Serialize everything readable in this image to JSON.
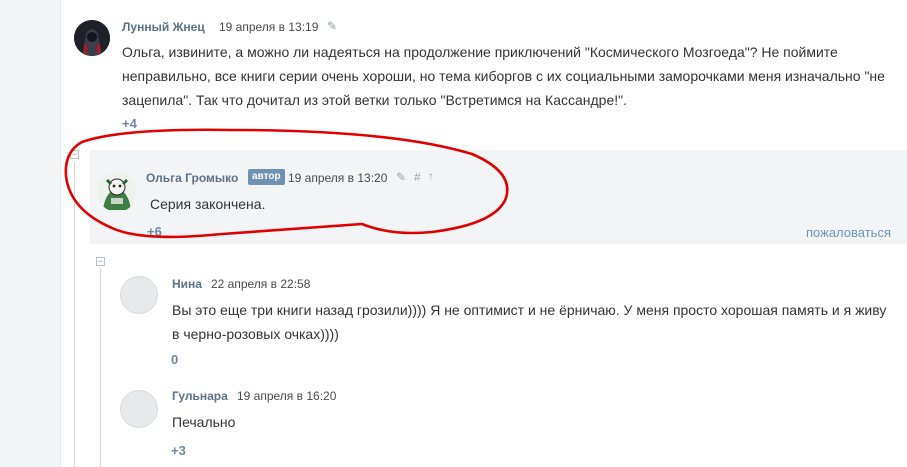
{
  "comments": [
    {
      "author": "Лунный Жнец",
      "date": "19 апреля в 13:19",
      "text_line1": "Ольга, извините, а можно ли надеяться на продолжение приключений \"Космического Мозгоеда\"? Не поймите",
      "text_line2": "неправильно, все книги серии очень хороши, но тема киборгов с их социальными заморочками меня изначально \"не",
      "text_line3": "зацепила\". Так что дочитал из этой ветки только \"Встретимся на Кассандре!\".",
      "rating": "+4",
      "avatar_icon": "dark-hooded-figure-avatar"
    },
    {
      "author": "Ольга Громыко",
      "badge": "автор",
      "date": "19 апреля в 13:20",
      "text": "Серия закончена.",
      "rating": "+6",
      "report": "пожаловаться",
      "collapse": "⊟",
      "edit_icon": "✎",
      "hash_icon": "#",
      "up_icon": "↑",
      "highlight_color": "#e00000"
    },
    {
      "author": "Нина",
      "date": "22 апреля в 22:58",
      "text_line1": "Вы это еще три книги назад грозили)))) Я не оптимист и не ёрничаю. У меня просто хорошая память и я живу",
      "text_line2": "в черно-розовых очках))))",
      "rating": "0",
      "collapse": "⊟"
    },
    {
      "author": "Гульнара",
      "date": "19 апреля в 16:20",
      "text": "Печально",
      "rating": "+3"
    }
  ],
  "first_edit_icon": "✎"
}
